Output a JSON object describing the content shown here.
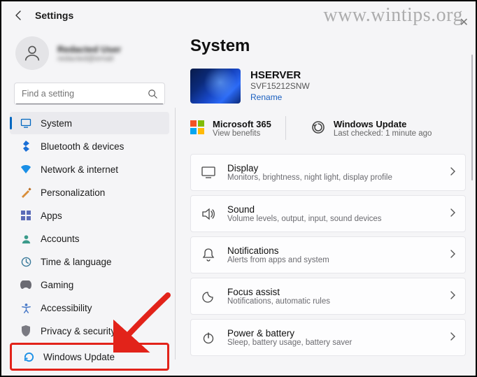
{
  "header": {
    "title": "Settings"
  },
  "profile": {
    "name": "Redacted User",
    "email": "redacted@email"
  },
  "search": {
    "placeholder": "Find a setting"
  },
  "sidebar": {
    "items": [
      {
        "label": "System"
      },
      {
        "label": "Bluetooth & devices"
      },
      {
        "label": "Network & internet"
      },
      {
        "label": "Personalization"
      },
      {
        "label": "Apps"
      },
      {
        "label": "Accounts"
      },
      {
        "label": "Time & language"
      },
      {
        "label": "Gaming"
      },
      {
        "label": "Accessibility"
      },
      {
        "label": "Privacy & security"
      },
      {
        "label": "Windows Update"
      }
    ]
  },
  "main": {
    "title": "System",
    "device": {
      "name": "HSERVER",
      "model": "SVF15212SNW",
      "rename": "Rename"
    },
    "tiles": {
      "ms365": {
        "label": "Microsoft 365",
        "sub": "View benefits"
      },
      "wu": {
        "label": "Windows Update",
        "sub": "Last checked: 1 minute ago"
      }
    },
    "cards": [
      {
        "title": "Display",
        "sub": "Monitors, brightness, night light, display profile"
      },
      {
        "title": "Sound",
        "sub": "Volume levels, output, input, sound devices"
      },
      {
        "title": "Notifications",
        "sub": "Alerts from apps and system"
      },
      {
        "title": "Focus assist",
        "sub": "Notifications, automatic rules"
      },
      {
        "title": "Power & battery",
        "sub": "Sleep, battery usage, battery saver"
      }
    ]
  },
  "watermark": "www.wintips.org"
}
